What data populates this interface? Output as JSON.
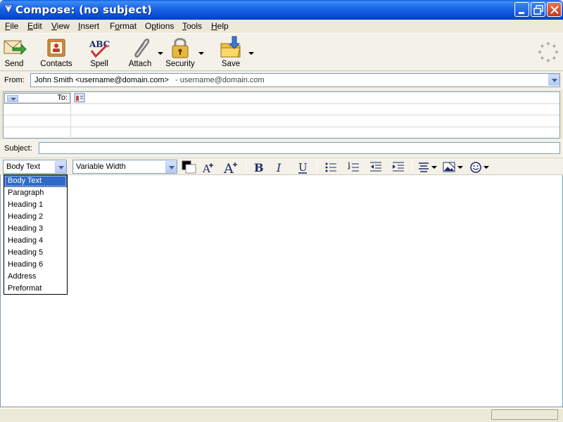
{
  "window": {
    "title": "Compose: (no subject)",
    "controls": [
      "minimize",
      "maximize",
      "close"
    ]
  },
  "menu": {
    "items": [
      {
        "label": "File",
        "key": "F"
      },
      {
        "label": "Edit",
        "key": "E"
      },
      {
        "label": "View",
        "key": "V"
      },
      {
        "label": "Insert",
        "key": "I"
      },
      {
        "label": "Format",
        "key": "o"
      },
      {
        "label": "Options",
        "key": "p"
      },
      {
        "label": "Tools",
        "key": "T"
      },
      {
        "label": "Help",
        "key": "H"
      }
    ]
  },
  "toolbar": {
    "send": "Send",
    "contacts": "Contacts",
    "spell": "Spell",
    "attach": "Attach",
    "security": "Security",
    "save": "Save"
  },
  "from": {
    "label": "From:",
    "name": "John Smith <username@domain.com>",
    "account": "- username@domain.com"
  },
  "recipients": {
    "type_label": "To:",
    "value": ""
  },
  "subject": {
    "label": "Subject:",
    "value": ""
  },
  "format": {
    "paragraph_style": "Body Text",
    "font": "Variable Width",
    "text_color": "#000000",
    "paragraph_options": [
      "Body Text",
      "Paragraph",
      "Heading 1",
      "Heading 2",
      "Heading 3",
      "Heading 4",
      "Heading 5",
      "Heading 6",
      "Address",
      "Preformat"
    ],
    "selected_option": 0
  },
  "colors": {
    "titlebar": "#0a5fe0",
    "selection": "#316ac5",
    "chrome": "#ece9d8"
  }
}
